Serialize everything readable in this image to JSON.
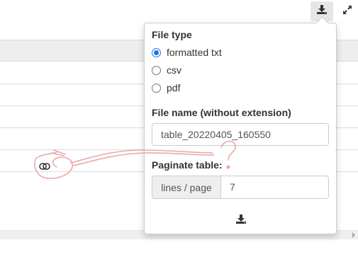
{
  "toolbar": {
    "download_icon": "download-icon",
    "expand_icon": "expand-icon"
  },
  "table": {
    "link_icon": "link-icon"
  },
  "export_popover": {
    "file_type": {
      "label": "File type",
      "options": [
        {
          "label": "formatted txt",
          "selected": true
        },
        {
          "label": "csv",
          "selected": false
        },
        {
          "label": "pdf",
          "selected": false
        }
      ]
    },
    "file_name": {
      "label": "File name (without extension)",
      "value": "table_20220405_160550"
    },
    "paginate": {
      "label": "Paginate table:",
      "addon": "lines / page",
      "value": "7"
    },
    "download_icon": "download-icon"
  },
  "annotation": {
    "mark": "?",
    "color": "#e8a0a0"
  },
  "colors": {
    "accent": "#1a73e8",
    "header_bg": "#eeeeee",
    "border": "#cccccc"
  }
}
